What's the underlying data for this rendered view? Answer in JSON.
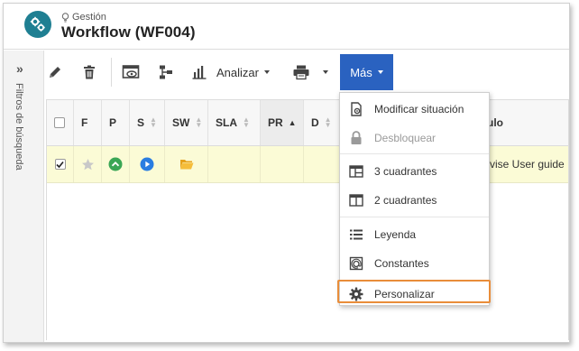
{
  "header": {
    "breadcrumb": "Gestión",
    "title": "Workflow (WF004)"
  },
  "sidebar": {
    "toggle_glyph": "»",
    "label": "Filtros de búsqueda"
  },
  "toolbar": {
    "analyze_label": "Analizar",
    "more_label": "Más"
  },
  "grid": {
    "columns": [
      "F",
      "P",
      "S",
      "SW",
      "SLA",
      "PR",
      "D"
    ],
    "partial_column": "ulo",
    "row": {
      "title_fragment": "vise User guide",
      "checked": true
    }
  },
  "menu": {
    "items": [
      {
        "label": "Modificar situación",
        "icon": "edit-document-icon",
        "enabled": true
      },
      {
        "label": "Desbloquear",
        "icon": "lock-icon",
        "enabled": false
      },
      {
        "label": "3 cuadrantes",
        "icon": "three-panes-icon",
        "enabled": true
      },
      {
        "label": "2 cuadrantes",
        "icon": "two-panes-icon",
        "enabled": true
      },
      {
        "label": "Leyenda",
        "icon": "list-icon",
        "enabled": true
      },
      {
        "label": "Constantes",
        "icon": "constants-icon",
        "enabled": true
      },
      {
        "label": "Personalizar",
        "icon": "gear-icon",
        "enabled": true,
        "highlighted": true
      }
    ]
  },
  "colors": {
    "brand": "#1f7f92",
    "primary_button": "#2a62c0",
    "row_highlight": "#fbfbd6",
    "focus_outline": "#e98d3a",
    "status_green": "#3aa655",
    "status_blue": "#2a7de1"
  }
}
